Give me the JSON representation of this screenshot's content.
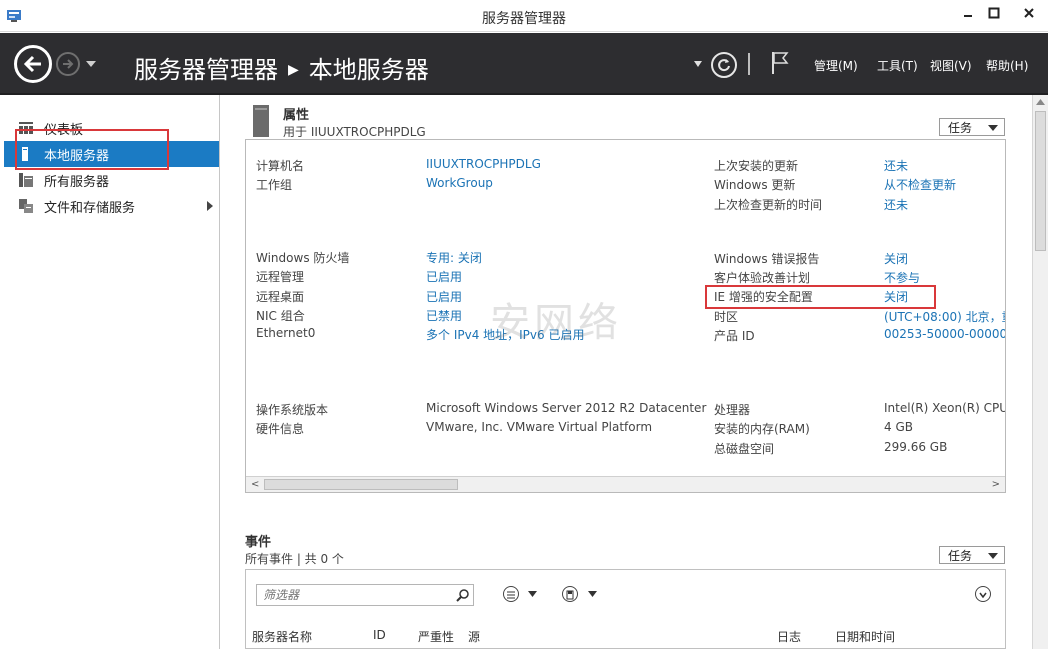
{
  "window": {
    "title": "服务器管理器"
  },
  "header": {
    "breadcrumb_root": "服务器管理器",
    "breadcrumb_current": "本地服务器",
    "menu": [
      {
        "label": "管理(M)"
      },
      {
        "label": "工具(T)"
      },
      {
        "label": "视图(V)"
      },
      {
        "label": "帮助(H)"
      }
    ]
  },
  "sidebar": {
    "items": [
      {
        "label": "仪表板",
        "icon": "dashboard-icon"
      },
      {
        "label": "本地服务器",
        "icon": "server-icon",
        "active": true
      },
      {
        "label": "所有服务器",
        "icon": "servers-icon"
      },
      {
        "label": "文件和存储服务",
        "icon": "file-storage-icon"
      }
    ]
  },
  "properties": {
    "title": "属性",
    "subtitle": "用于 IIUUXTROCPHPDLG",
    "tasks_label": "任务",
    "left": [
      {
        "label": "计算机名",
        "value": "IIUUXTROCPHPDLG"
      },
      {
        "label": "工作组",
        "value": "WorkGroup"
      },
      {
        "label": "Windows 防火墙",
        "value": "专用: 关闭"
      },
      {
        "label": "远程管理",
        "value": "已启用"
      },
      {
        "label": "远程桌面",
        "value": "已启用"
      },
      {
        "label": "NIC 组合",
        "value": "已禁用"
      },
      {
        "label": "Ethernet0",
        "value": "多个 IPv4 地址，IPv6 已启用"
      },
      {
        "label": "操作系统版本",
        "value": "Microsoft Windows Server 2012 R2 Datacenter"
      },
      {
        "label": "硬件信息",
        "value": "VMware, Inc. VMware Virtual Platform"
      }
    ],
    "right": [
      {
        "label": "上次安装的更新",
        "value": "还未"
      },
      {
        "label": "Windows 更新",
        "value": "从不检查更新"
      },
      {
        "label": "上次检查更新的时间",
        "value": "还未"
      },
      {
        "label": "Windows 错误报告",
        "value": "关闭"
      },
      {
        "label": "客户体验改善计划",
        "value": "不参与"
      },
      {
        "label": "IE 增强的安全配置",
        "value": "关闭"
      },
      {
        "label": "时区",
        "value": "(UTC+08:00) 北京，重"
      },
      {
        "label": "产品 ID",
        "value": "00253-50000-00000-"
      },
      {
        "label": "处理器",
        "value": "Intel(R) Xeon(R) CPU"
      },
      {
        "label": "安装的内存(RAM)",
        "value": "4 GB"
      },
      {
        "label": "总磁盘空间",
        "value": "299.66 GB"
      }
    ]
  },
  "events": {
    "title": "事件",
    "subtitle": "所有事件 | 共 0 个",
    "tasks_label": "任务",
    "filter_placeholder": "筛选器",
    "columns": [
      "服务器名称",
      "ID",
      "严重性",
      "源",
      "日志",
      "日期和时间"
    ]
  },
  "watermark": "安网络",
  "colors": {
    "header_bg": "#2d2d30",
    "accent": "#1b7bc4",
    "link": "#1b73b5",
    "highlight": "#d9383a"
  }
}
